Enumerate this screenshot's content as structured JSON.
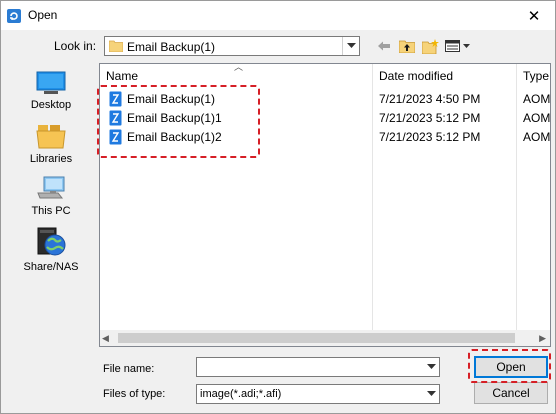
{
  "window": {
    "title": "Open",
    "close_symbol": "✕"
  },
  "lookin": {
    "label": "Look in:",
    "value": "Email Backup(1)"
  },
  "places": [
    {
      "label": "Desktop",
      "icon": "desktop-icon"
    },
    {
      "label": "Libraries",
      "icon": "libraries-icon"
    },
    {
      "label": "This PC",
      "icon": "this-pc-icon"
    },
    {
      "label": "Share/NAS",
      "icon": "share-nas-icon"
    }
  ],
  "filelist": {
    "columns": {
      "name": "Name",
      "date": "Date modified",
      "type": "Type"
    },
    "rows": [
      {
        "name": "Email Backup(1)",
        "date": "7/21/2023 4:50 PM",
        "type": "AOM"
      },
      {
        "name": "Email Backup(1)1",
        "date": "7/21/2023 5:12 PM",
        "type": "AOM"
      },
      {
        "name": "Email Backup(1)2",
        "date": "7/21/2023 5:12 PM",
        "type": "AOM"
      }
    ]
  },
  "filename": {
    "label": "File name:",
    "value": ""
  },
  "filetype": {
    "label": "Files of type:",
    "value": "image(*.adi;*.afi)"
  },
  "buttons": {
    "open": "Open",
    "cancel": "Cancel"
  },
  "colors": {
    "highlight_border": "#d61f26",
    "accent": "#0078d7"
  }
}
